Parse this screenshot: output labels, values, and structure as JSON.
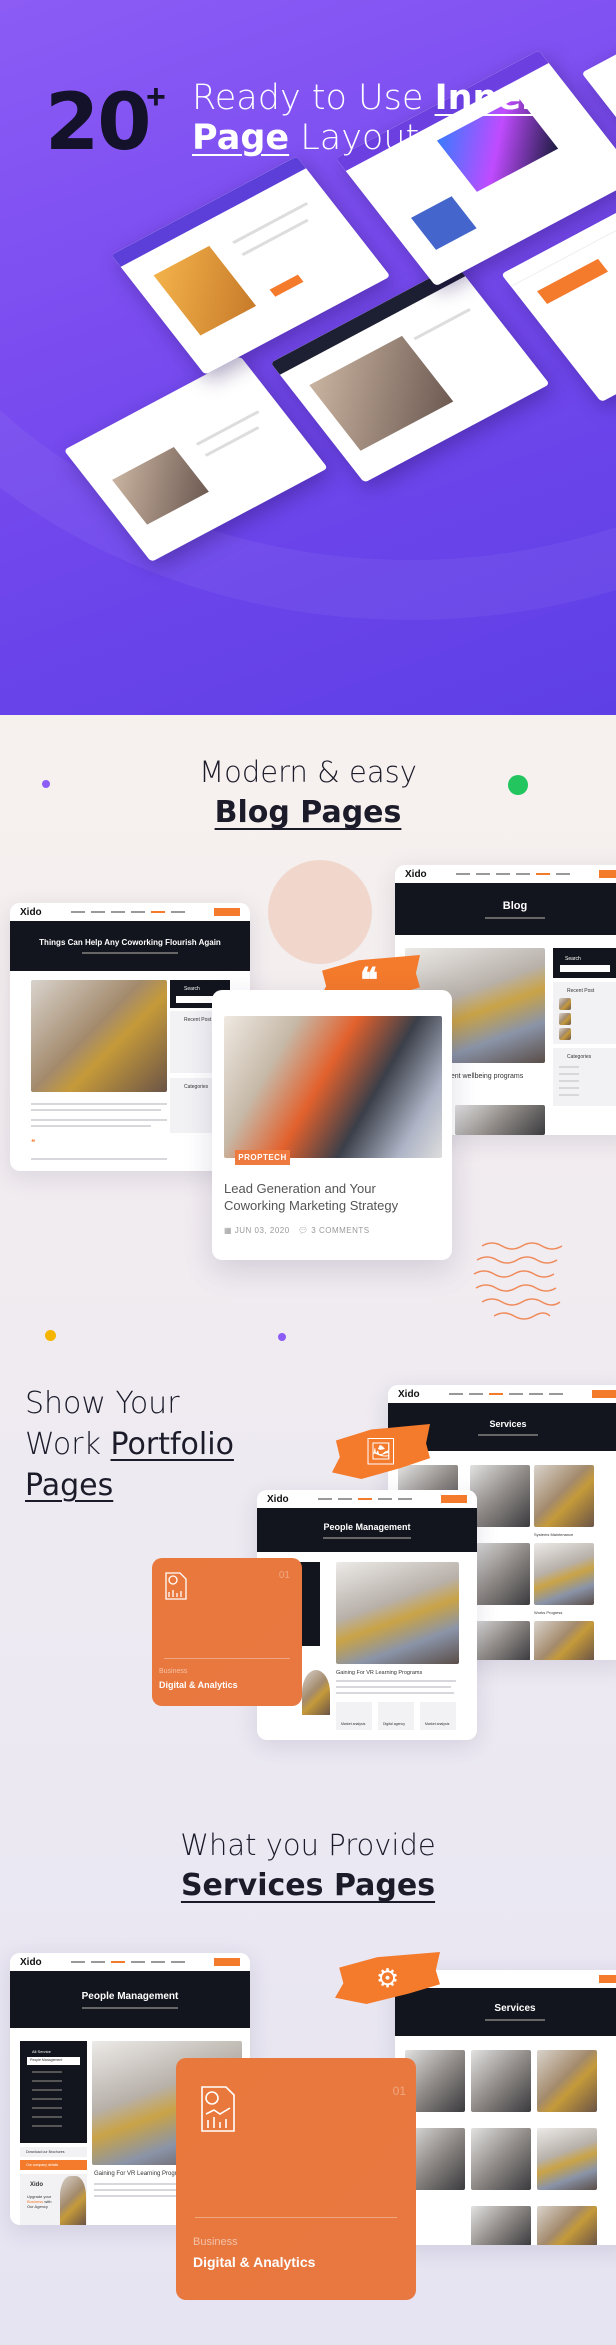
{
  "hero": {
    "count": "20",
    "plus": "+",
    "line1_pre": "Ready to Use ",
    "line1_bold": "Inner",
    "line2_bold": "Page",
    "line2_post": " Layouts"
  },
  "blog_section": {
    "heading": "Modern & easy",
    "subheading": "Blog Pages",
    "left_mock": {
      "logo": "Xido",
      "title": "Things Can Help Any Coworking Flourish Again",
      "search": "Search",
      "recent": "Recent Post",
      "categories": "Categories"
    },
    "right_mock": {
      "logo": "Xido",
      "title": "Blog",
      "search": "Search",
      "recent": "Recent Post",
      "categories": "Categories",
      "post_title": "ment wellbeing programs"
    },
    "card": {
      "category": "PROPTECH",
      "title": "Lead Generation and Your Coworking Marketing Strategy",
      "date": "JUN 03, 2020",
      "comments": "3 COMMENTS"
    }
  },
  "portfolio_section": {
    "line1": "Show Your",
    "line2_pre": "Work ",
    "line2_bold": "Portfolio",
    "line3_bold": "Pages",
    "services_mock": {
      "logo": "Xido",
      "title": "Services",
      "captions": [
        "Systems Maintenance",
        "Works Progress"
      ]
    },
    "people_mock": {
      "logo": "Xido",
      "title": "People Management",
      "heading": "Gaining For VR Learning Programs",
      "features": [
        "Market analysis",
        "Digital agency",
        "Market analysis"
      ]
    },
    "card": {
      "number": "01",
      "category": "Business",
      "title": "Digital & Analytics"
    }
  },
  "services_section": {
    "heading": "What you Provide",
    "subheading": "Services Pages",
    "people_mock": {
      "logo": "Xido",
      "title": "People Management",
      "sidebar_title": "All Service",
      "sidebar_active": "People Management",
      "brochure": "Download our Brochures",
      "details": "Our company details",
      "promo_logo": "Xido",
      "promo_pre": "Upgrade your ",
      "promo_accent": "Business",
      "promo_post": " with Our Agency",
      "heading": "Gaining For VR Learning Programs"
    },
    "services_mock": {
      "title": "Services"
    },
    "card": {
      "number": "01",
      "category": "Business",
      "title": "Digital & Analytics"
    }
  },
  "colors": {
    "accent": "#f47a2c",
    "hero_purple": "#7a4cf0",
    "dark": "#12151d",
    "green_dot": "#22c55e",
    "purple_dot": "#8b5cf6",
    "yellow_dot": "#f5b400"
  },
  "icons": {
    "blog_brush": "quote-icon",
    "portfolio_brush": "image-icon",
    "services_brush": "gear-icon",
    "card_icon": "report-chart-icon"
  }
}
